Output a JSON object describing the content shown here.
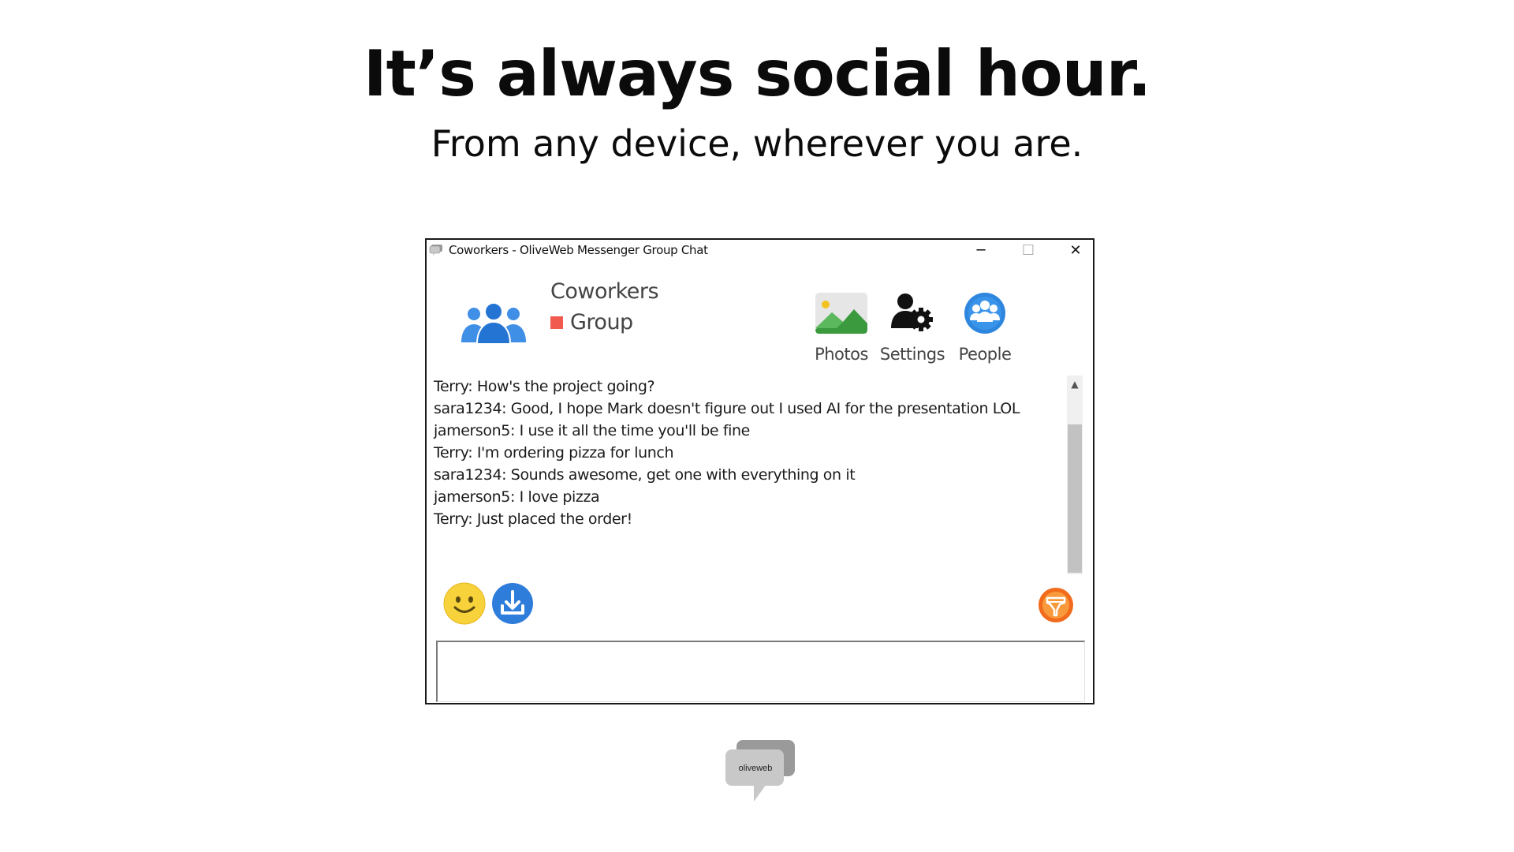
{
  "hero": {
    "title": "It’s always social hour.",
    "subtitle": "From any device, wherever you are."
  },
  "window": {
    "title": "Coworkers - OliveWeb Messenger Group Chat",
    "controls": {
      "minimize": "─",
      "maximize": "☐",
      "close": "✕"
    }
  },
  "group": {
    "name": "Coworkers",
    "type": "Group",
    "status_color": "#f05a4f"
  },
  "toolbar": {
    "photos_label": "Photos",
    "settings_label": "Settings",
    "people_label": "People"
  },
  "chat": {
    "messages": [
      "Terry: How's the project going?",
      "sara1234: Good, I hope Mark doesn't figure out I used AI for the presentation LOL",
      "jamerson5: I use it all the time you'll be fine",
      "Terry: I'm ordering pizza for lunch",
      "sara1234: Sounds awesome, get one with everything on it",
      "jamerson5: I love pizza",
      "Terry: Just placed the order!"
    ]
  },
  "composer": {
    "value": ""
  },
  "icons": {
    "group": "people-group-icon",
    "photos": "photo-landscape-icon",
    "settings": "user-gear-icon",
    "people": "people-circle-icon",
    "emoji": "smiley-face-icon",
    "download": "download-icon",
    "nudge": "nudge-icon"
  },
  "brand": {
    "name": "oliveweb"
  },
  "colors": {
    "accent_blue": "#2f7ddb",
    "status_red": "#f05a4f",
    "emoji_yellow": "#f7d23b",
    "nudge_orange": "#f26b1d"
  }
}
